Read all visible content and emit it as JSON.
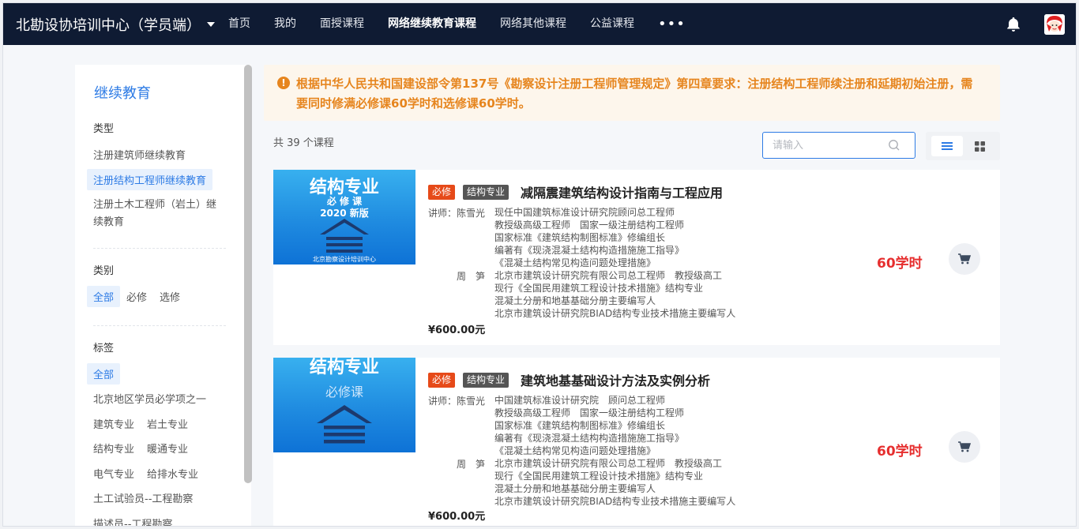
{
  "nav": {
    "brand": "北勘设协培训中心（学员端）",
    "items": [
      "首页",
      "我的",
      "面授课程",
      "网络继续教育课程",
      "网络其他课程",
      "公益课程"
    ],
    "active_index": 3,
    "more_label": "•••",
    "bg_color": "#0f1b33"
  },
  "sidebar": {
    "title": "继续教育",
    "type_heading": "类型",
    "types": [
      "注册建筑师继续教育",
      "注册结构工程师继续教育",
      "注册土木工程师（岩土）继",
      "续教育"
    ],
    "category_heading": "类别",
    "categories": [
      "全部",
      "必修",
      "选修"
    ],
    "tag_heading": "标签",
    "tags": [
      "全部",
      "北京地区学员必学项之一",
      "建筑专业",
      "岩土专业",
      "结构专业",
      "暖通专业",
      "电气专业",
      "给排水专业",
      "土工试验员--工程勘察",
      "描述员--工程勘察"
    ]
  },
  "notice": {
    "text": "根据中华人民共和国建设部令第137号《勘察设计注册工程师管理规定》第四章要求：注册结构工程师续注册和延期初始注册，需要同时修满必修课60学时和选修课60学时。",
    "color": "#e6851e"
  },
  "list": {
    "count_text": "共 39 个课程",
    "search_placeholder": "请输入"
  },
  "courses": [
    {
      "thumb_title": "结构专业",
      "thumb_sub": "必 修 课",
      "thumb_version": "2020 新版",
      "thumb_footer": "北京勘察设计培训中心",
      "tag_required": "必修",
      "tag_category": "结构专业",
      "title": "减隔震建筑结构设计指南与工程应用",
      "lecturer_label": "讲师：陈雪光",
      "lecturer_lines": [
        "现任中国建筑标准设计研究院顾问总工程师",
        "教授级高级工程师　国家一级注册结构工程师",
        "国家标准《建筑结构制图标准》修编组长",
        "编著有《现浇混凝土结构构造措施施工指导》",
        "《混凝土结构常见构造问题处理措施》"
      ],
      "co_label": "周　笋",
      "co_lines": [
        "北京市建筑设计研究院有限公司总工程师　教授级高工",
        "现行《全国民用建筑工程设计技术措施》结构专业",
        "混凝土分册和地基基础分册主要编写人",
        "北京市建筑设计研究院BIAD结构专业技术措施主要编写人"
      ],
      "price": "¥600.00元",
      "hours": "60学时"
    },
    {
      "thumb_title": "结构专业",
      "thumb_sub": "必修课",
      "thumb_version": "",
      "thumb_footer": "",
      "tag_required": "必修",
      "tag_category": "结构专业",
      "title": "建筑地基基础设计方法及实例分析",
      "lecturer_label": "讲师：陈雪光",
      "lecturer_lines": [
        "中国建筑标准设计研究院　顾问总工程师",
        "教授级高级工程师　国家一级注册结构工程师",
        "国家标准《建筑结构制图标准》修编组长",
        "编著有《现浇混凝土结构构造措施施工指导》",
        "《混凝土结构常见构造问题处理措施》"
      ],
      "co_label": "周　笋",
      "co_lines": [
        "北京市建筑设计研究院有限公司总工程师　教授级高工",
        "现行《全国民用建筑工程设计技术措施》结构专业",
        "混凝土分册和地基基础分册主要编写人",
        "北京市建筑设计研究院BIAD结构专业技术措施主要编写人"
      ],
      "price": "¥600.00元",
      "hours": "60学时"
    }
  ]
}
